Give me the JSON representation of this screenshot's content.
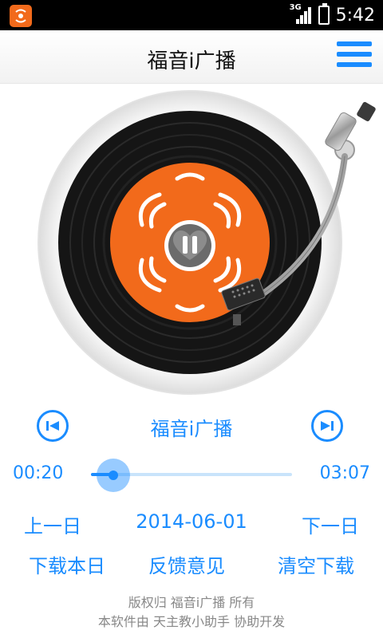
{
  "status_bar": {
    "network": "3G",
    "time": "5:42"
  },
  "header": {
    "title": "福音i广播"
  },
  "player": {
    "track_title": "福音i广播",
    "elapsed": "00:20",
    "duration": "03:07",
    "progress": 0.11,
    "date": "2014-06-01",
    "prev_day": "上一日",
    "next_day": "下一日"
  },
  "actions": {
    "download_today": "下载本日",
    "feedback": "反馈意见",
    "clear_downloads": "清空下载"
  },
  "footer": {
    "copyright": "版权归 福音i广播 所有",
    "credits": "本软件由 天主教小助手 协助开发"
  },
  "colors": {
    "accent": "#1a8cff",
    "label_orange": "#f26a1b"
  }
}
